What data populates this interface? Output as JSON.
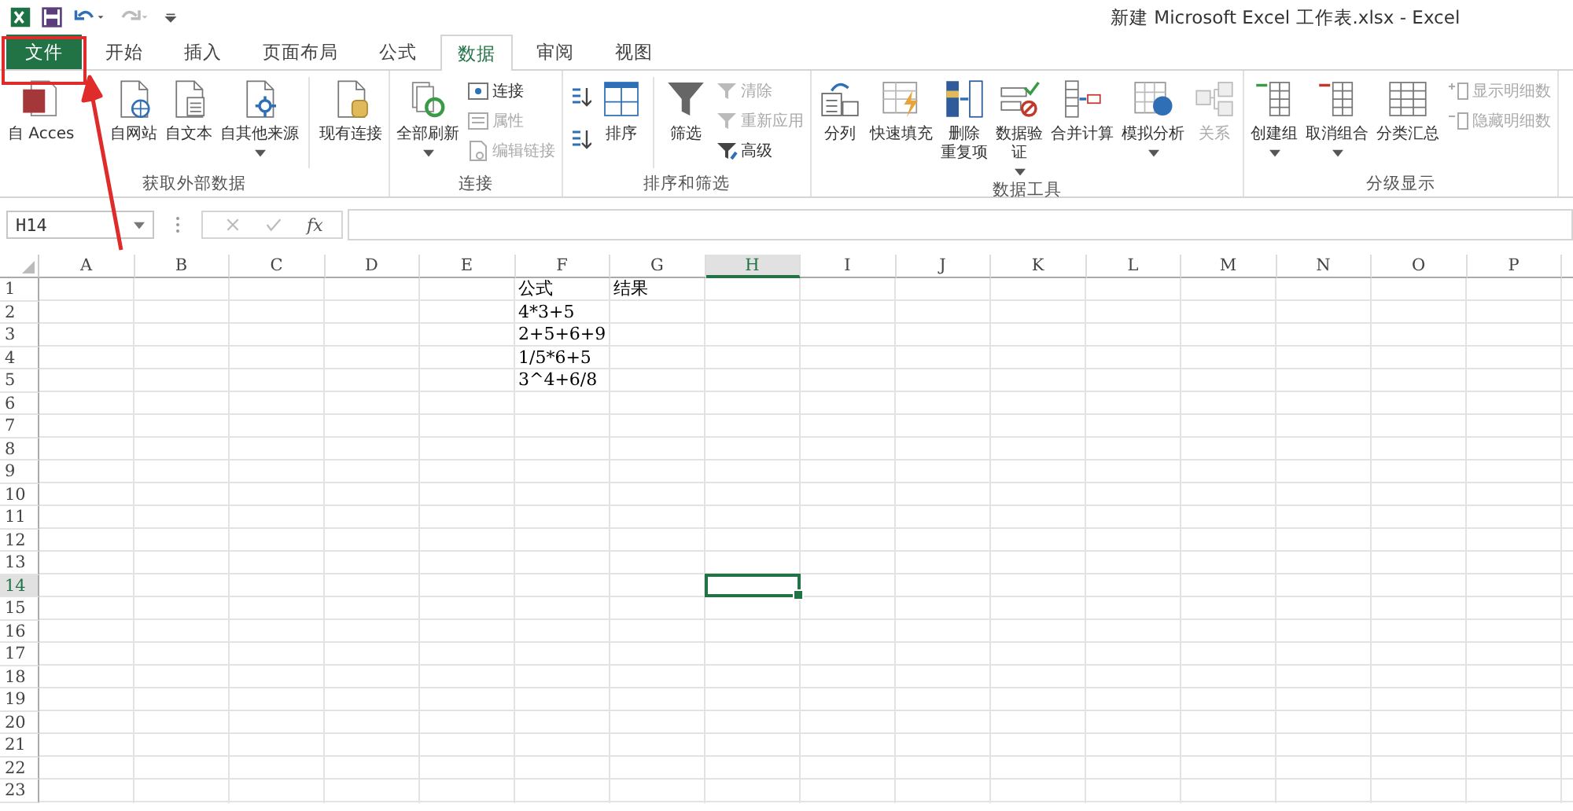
{
  "title_bar": {
    "title": "新建 Microsoft Excel 工作表.xlsx - Excel",
    "redo_disabled": true
  },
  "tabs": [
    {
      "label": "文件",
      "kind": "file",
      "selected": false
    },
    {
      "label": "开始",
      "kind": "tab",
      "selected": false
    },
    {
      "label": "插入",
      "kind": "tab",
      "selected": false
    },
    {
      "label": "页面布局",
      "kind": "tab",
      "selected": false
    },
    {
      "label": "公式",
      "kind": "tab",
      "selected": false
    },
    {
      "label": "数据",
      "kind": "tab",
      "selected": true
    },
    {
      "label": "审阅",
      "kind": "tab",
      "selected": false
    },
    {
      "label": "视图",
      "kind": "tab",
      "selected": false
    }
  ],
  "ribbon": {
    "groups": [
      {
        "label": "获取外部数据",
        "controls": [
          {
            "kind": "large",
            "lines": [
              "自 Acces"
            ],
            "dropdown": false,
            "disabled": false
          },
          {
            "kind": "large",
            "lines": [
              "自网站"
            ],
            "dropdown": false,
            "disabled": false
          },
          {
            "kind": "large",
            "lines": [
              "自文本"
            ],
            "dropdown": false,
            "disabled": false
          },
          {
            "kind": "large",
            "lines": [
              "自其他来源"
            ],
            "dropdown": true,
            "disabled": false
          },
          {
            "kind": "separator"
          },
          {
            "kind": "large",
            "lines": [
              "现有连接"
            ],
            "dropdown": false,
            "disabled": false
          }
        ]
      },
      {
        "label": "连接",
        "controls": [
          {
            "kind": "large",
            "lines": [
              "全部刷新"
            ],
            "dropdown": true,
            "disabled": false
          },
          {
            "kind": "stack",
            "items": [
              {
                "kind": "labeled",
                "label": "连接",
                "disabled": false
              },
              {
                "kind": "labeled",
                "label": "属性",
                "disabled": true
              },
              {
                "kind": "labeled",
                "label": "编辑链接",
                "disabled": true
              }
            ]
          }
        ]
      },
      {
        "label": "排序和筛选",
        "controls": [
          {
            "kind": "stack",
            "items": [
              {
                "kind": "icon-only",
                "disabled": false
              },
              {
                "kind": "icon-only",
                "disabled": false
              }
            ]
          },
          {
            "kind": "large",
            "lines": [
              "排序"
            ],
            "dropdown": false,
            "disabled": false
          },
          {
            "kind": "separator"
          },
          {
            "kind": "large",
            "lines": [
              "筛选"
            ],
            "dropdown": false,
            "disabled": false
          },
          {
            "kind": "stack",
            "items": [
              {
                "kind": "labeled",
                "label": "清除",
                "disabled": true
              },
              {
                "kind": "labeled",
                "label": "重新应用",
                "disabled": true
              },
              {
                "kind": "labeled",
                "label": "高级",
                "disabled": false
              }
            ]
          }
        ]
      },
      {
        "label": "数据工具",
        "controls": [
          {
            "kind": "large",
            "lines": [
              "分列"
            ],
            "dropdown": false,
            "disabled": false
          },
          {
            "kind": "large",
            "lines": [
              "快速填充"
            ],
            "dropdown": false,
            "disabled": false
          },
          {
            "kind": "large",
            "lines": [
              "删除",
              "重复项"
            ],
            "dropdown": false,
            "disabled": false
          },
          {
            "kind": "large",
            "lines": [
              "数据验",
              "证"
            ],
            "dropdown": true,
            "disabled": false
          },
          {
            "kind": "large",
            "lines": [
              "合并计算"
            ],
            "dropdown": false,
            "disabled": false
          },
          {
            "kind": "large",
            "lines": [
              "模拟分析"
            ],
            "dropdown": true,
            "disabled": false
          },
          {
            "kind": "large",
            "lines": [
              "关系"
            ],
            "dropdown": false,
            "disabled": true
          }
        ]
      },
      {
        "label": "分级显示",
        "controls": [
          {
            "kind": "large",
            "lines": [
              "创建组"
            ],
            "dropdown": true,
            "disabled": false
          },
          {
            "kind": "large",
            "lines": [
              "取消组合"
            ],
            "dropdown": true,
            "disabled": false
          },
          {
            "kind": "large",
            "lines": [
              "分类汇总"
            ],
            "dropdown": false,
            "disabled": false
          },
          {
            "kind": "stack",
            "items": [
              {
                "kind": "labeled",
                "label": "显示明细数",
                "disabled": true
              },
              {
                "kind": "labeled",
                "label": "隐藏明细数",
                "disabled": true
              }
            ]
          }
        ]
      }
    ]
  },
  "formula_bar": {
    "name_box": "H14",
    "function_label": "fx"
  },
  "sheet": {
    "columns": [
      {
        "label": "A",
        "selected": false
      },
      {
        "label": "B",
        "selected": false
      },
      {
        "label": "C",
        "selected": false
      },
      {
        "label": "D",
        "selected": false
      },
      {
        "label": "E",
        "selected": false
      },
      {
        "label": "F",
        "selected": false,
        "cells": [
          "公式",
          "4*3+5",
          "2+5+6+9",
          "1/5*6+5",
          "3^4+6/8"
        ]
      },
      {
        "label": "G",
        "selected": false,
        "cells": [
          "结果"
        ]
      },
      {
        "label": "H",
        "selected": true
      },
      {
        "label": "I",
        "selected": false
      },
      {
        "label": "J",
        "selected": false
      },
      {
        "label": "K",
        "selected": false
      },
      {
        "label": "L",
        "selected": false
      },
      {
        "label": "M",
        "selected": false
      },
      {
        "label": "N",
        "selected": false
      },
      {
        "label": "O",
        "selected": false
      },
      {
        "label": "P",
        "selected": false
      }
    ],
    "rows": [
      {
        "label": "1",
        "selected": false
      },
      {
        "label": "2",
        "selected": false
      },
      {
        "label": "3",
        "selected": false
      },
      {
        "label": "4",
        "selected": false
      },
      {
        "label": "5",
        "selected": false
      },
      {
        "label": "6",
        "selected": false
      },
      {
        "label": "7",
        "selected": false
      },
      {
        "label": "8",
        "selected": false
      },
      {
        "label": "9",
        "selected": false
      },
      {
        "label": "10",
        "selected": false
      },
      {
        "label": "11",
        "selected": false
      },
      {
        "label": "12",
        "selected": false
      },
      {
        "label": "13",
        "selected": false
      },
      {
        "label": "14",
        "selected": true
      },
      {
        "label": "15",
        "selected": false
      },
      {
        "label": "16",
        "selected": false
      },
      {
        "label": "17",
        "selected": false
      },
      {
        "label": "18",
        "selected": false
      },
      {
        "label": "19",
        "selected": false
      },
      {
        "label": "20",
        "selected": false
      },
      {
        "label": "21",
        "selected": false
      },
      {
        "label": "22",
        "selected": false
      },
      {
        "label": "23",
        "selected": false
      }
    ]
  },
  "annotations": {
    "file_tab_frame": true,
    "arrow": true
  }
}
